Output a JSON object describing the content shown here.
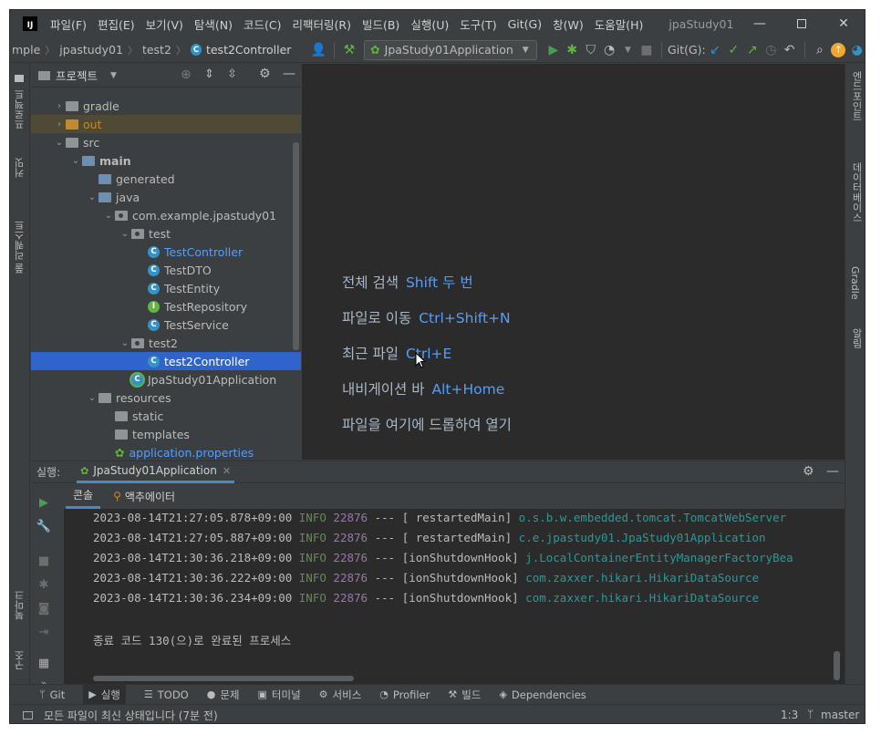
{
  "window": {
    "title": "jpaStudy01",
    "menu": [
      "파일(F)",
      "편집(E)",
      "보기(V)",
      "탐색(N)",
      "코드(C)",
      "리팩터링(R)",
      "빌드(B)",
      "실행(U)",
      "도구(T)",
      "Git(G)",
      "창(W)",
      "도움말(H)"
    ]
  },
  "navbar": {
    "breadcrumbs": [
      "mple",
      "jpastudy01",
      "test2",
      "test2Controller"
    ],
    "run_config": "JpaStudy01Application",
    "git_label": "Git(G):"
  },
  "left_strip": {
    "tabs": [
      "프로젝트",
      "커밋",
      "풀 리퀘스트",
      "북마크",
      "구조"
    ]
  },
  "right_strip": {
    "tabs": [
      "엔드포인트",
      "데이터베이스",
      "Gradle",
      "알림"
    ]
  },
  "project_panel": {
    "title": "프로젝트",
    "tree": [
      {
        "label": "gradle",
        "indent": 0,
        "arrow": "›",
        "icon": "folder"
      },
      {
        "label": "out",
        "indent": 0,
        "arrow": "›",
        "icon": "folder-orange"
      },
      {
        "label": "src",
        "indent": 0,
        "arrow": "⌄",
        "icon": "folder"
      },
      {
        "label": "main",
        "indent": 1,
        "arrow": "⌄",
        "icon": "folder-module"
      },
      {
        "label": "generated",
        "indent": 2,
        "arrow": "",
        "icon": "folder-gen"
      },
      {
        "label": "java",
        "indent": 2,
        "arrow": "⌄",
        "icon": "folder-blue"
      },
      {
        "label": "com.example.jpastudy01",
        "indent": 3,
        "arrow": "⌄",
        "icon": "package"
      },
      {
        "label": "test",
        "indent": 4,
        "arrow": "⌄",
        "icon": "package"
      },
      {
        "label": "TestController",
        "indent": 5,
        "arrow": "",
        "icon": "class"
      },
      {
        "label": "TestDTO",
        "indent": 5,
        "arrow": "",
        "icon": "class"
      },
      {
        "label": "TestEntity",
        "indent": 5,
        "arrow": "",
        "icon": "class"
      },
      {
        "label": "TestRepository",
        "indent": 5,
        "arrow": "",
        "icon": "interface"
      },
      {
        "label": "TestService",
        "indent": 5,
        "arrow": "",
        "icon": "class"
      },
      {
        "label": "test2",
        "indent": 4,
        "arrow": "⌄",
        "icon": "package"
      },
      {
        "label": "test2Controller",
        "indent": 5,
        "arrow": "",
        "icon": "class"
      },
      {
        "label": "JpaStudy01Application",
        "indent": 4,
        "arrow": "",
        "icon": "spring-class"
      },
      {
        "label": "resources",
        "indent": 2,
        "arrow": "⌄",
        "icon": "folder-res"
      },
      {
        "label": "static",
        "indent": 3,
        "arrow": "",
        "icon": "folder"
      },
      {
        "label": "templates",
        "indent": 3,
        "arrow": "",
        "icon": "folder"
      },
      {
        "label": "application.properties",
        "indent": 3,
        "arrow": "",
        "icon": "properties"
      }
    ]
  },
  "editor": {
    "hints": [
      {
        "text": "전체 검색",
        "key": "Shift 두 번"
      },
      {
        "text": "파일로 이동",
        "key": "Ctrl+Shift+N"
      },
      {
        "text": "최근 파일",
        "key": "Ctrl+E"
      },
      {
        "text": "내비게이션 바",
        "key": "Alt+Home"
      },
      {
        "text": "파일을 여기에 드롭하여 열기",
        "key": ""
      }
    ]
  },
  "run_panel": {
    "label": "실행:",
    "tab": "JpaStudy01Application",
    "subtabs": [
      "콘솔",
      "액추에이터"
    ],
    "log": [
      {
        "ts": "2023-08-14T21:27:05.878+09:00",
        "level": "INFO",
        "pid": "22876",
        "sep": "---",
        "thread": "[  restartedMain]",
        "cls": "o.s.b.w.embedded.tomcat.TomcatWebServer"
      },
      {
        "ts": "2023-08-14T21:27:05.887+09:00",
        "level": "INFO",
        "pid": "22876",
        "sep": "---",
        "thread": "[  restartedMain]",
        "cls": "c.e.jpastudy01.JpaStudy01Application"
      },
      {
        "ts": "2023-08-14T21:30:36.218+09:00",
        "level": "INFO",
        "pid": "22876",
        "sep": "---",
        "thread": "[ionShutdownHook]",
        "cls": "j.LocalContainerEntityManagerFactoryBea"
      },
      {
        "ts": "2023-08-14T21:30:36.222+09:00",
        "level": "INFO",
        "pid": "22876",
        "sep": "---",
        "thread": "[ionShutdownHook]",
        "cls": "com.zaxxer.hikari.HikariDataSource"
      },
      {
        "ts": "2023-08-14T21:30:36.234+09:00",
        "level": "INFO",
        "pid": "22876",
        "sep": "---",
        "thread": "[ionShutdownHook]",
        "cls": "com.zaxxer.hikari.HikariDataSource"
      }
    ],
    "exit_message": "종료 코드 130(으)로 완료된 프로세스"
  },
  "bottom_tools": [
    "Git",
    "실행",
    "TODO",
    "문제",
    "터미널",
    "서비스",
    "Profiler",
    "빌드",
    "Dependencies"
  ],
  "status": {
    "message": "모든 파일이 최신 상태입니다 (7분 전)",
    "position": "1:3",
    "branch": "master"
  }
}
